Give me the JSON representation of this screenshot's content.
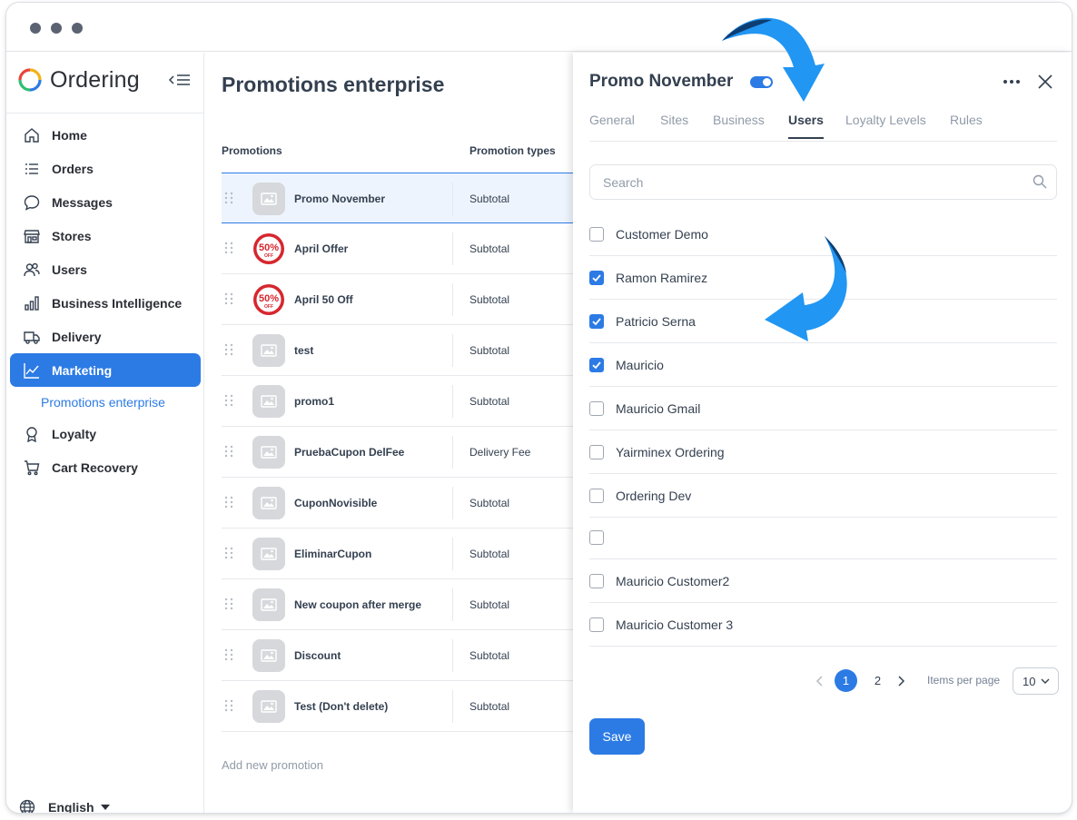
{
  "app": {
    "logo_text": "Ordering"
  },
  "sidebar": {
    "items": [
      {
        "label": "Home",
        "icon": "home-icon"
      },
      {
        "label": "Orders",
        "icon": "list-icon"
      },
      {
        "label": "Messages",
        "icon": "chat-icon"
      },
      {
        "label": "Stores",
        "icon": "store-icon"
      },
      {
        "label": "Users",
        "icon": "users-icon"
      },
      {
        "label": "Business Intelligence",
        "icon": "bar-chart-icon"
      },
      {
        "label": "Delivery",
        "icon": "truck-icon"
      },
      {
        "label": "Marketing",
        "icon": "trend-icon",
        "active": true
      },
      {
        "label": "Loyalty",
        "icon": "award-icon"
      },
      {
        "label": "Cart Recovery",
        "icon": "cart-icon"
      }
    ],
    "sub_item": "Promotions enterprise",
    "language": "English"
  },
  "main": {
    "title": "Promotions enterprise",
    "columns": {
      "promotions": "Promotions",
      "types": "Promotion types"
    },
    "rows": [
      {
        "name": "Promo November",
        "type": "Subtotal",
        "image": "placeholder",
        "selected": true
      },
      {
        "name": "April Offer",
        "type": "Subtotal",
        "image": "50-off-badge"
      },
      {
        "name": "April 50 Off",
        "type": "Subtotal",
        "image": "50-off-badge"
      },
      {
        "name": "test",
        "type": "Subtotal",
        "image": "placeholder"
      },
      {
        "name": "promo1",
        "type": "Subtotal",
        "image": "placeholder"
      },
      {
        "name": "PruebaCupon DelFee",
        "type": "Delivery Fee",
        "image": "placeholder"
      },
      {
        "name": "CuponNovisible",
        "type": "Subtotal",
        "image": "placeholder"
      },
      {
        "name": "EliminarCupon",
        "type": "Subtotal",
        "image": "placeholder"
      },
      {
        "name": "New coupon after merge",
        "type": "Subtotal",
        "image": "placeholder"
      },
      {
        "name": "Discount",
        "type": "Subtotal",
        "image": "placeholder"
      },
      {
        "name": "Test (Don't delete)",
        "type": "Subtotal",
        "image": "placeholder"
      }
    ],
    "add_label": "Add new promotion",
    "badge_text": "50%",
    "badge_sub": "OFF"
  },
  "panel": {
    "title": "Promo November",
    "enabled": true,
    "tabs": [
      "General",
      "Sites",
      "Business",
      "Users",
      "Loyalty Levels",
      "Rules"
    ],
    "active_tab": "Users",
    "search_placeholder": "Search",
    "users": [
      {
        "name": "Customer Demo",
        "checked": false
      },
      {
        "name": "Ramon Ramirez",
        "checked": true
      },
      {
        "name": "Patricio Serna",
        "checked": true
      },
      {
        "name": "Mauricio",
        "checked": true
      },
      {
        "name": "Mauricio Gmail",
        "checked": false
      },
      {
        "name": "Yairminex Ordering",
        "checked": false
      },
      {
        "name": "Ordering Dev",
        "checked": false
      },
      {
        "name": "",
        "checked": false
      },
      {
        "name": "Mauricio Customer2",
        "checked": false
      },
      {
        "name": "Mauricio Customer 3",
        "checked": false
      }
    ],
    "pagination": {
      "pages": [
        "1",
        "2"
      ],
      "current": "1",
      "items_per_page_label": "Items per page",
      "items_per_page": "10"
    },
    "save_label": "Save"
  },
  "colors": {
    "accent": "#2c7be5",
    "arrow": "#2196f3",
    "arrow_dark": "#0d3e73"
  }
}
